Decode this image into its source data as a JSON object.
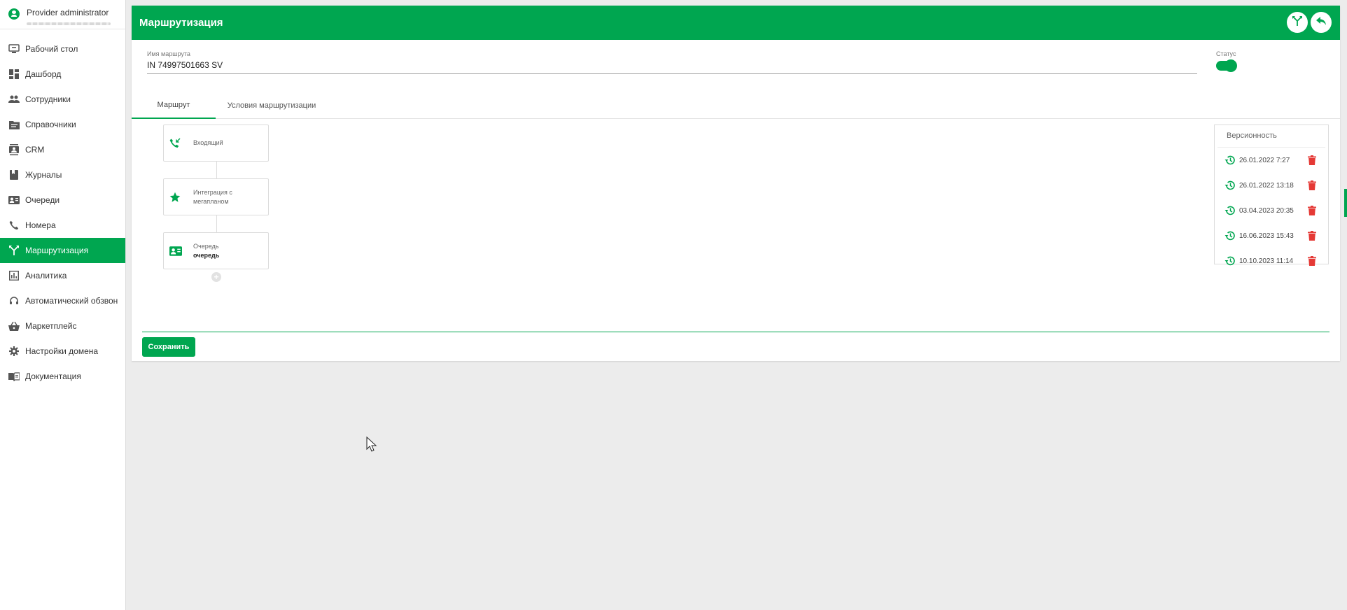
{
  "user": {
    "name": "Provider administrator"
  },
  "sidebar": {
    "items": [
      {
        "label": "Рабочий стол",
        "icon": "desktop-icon"
      },
      {
        "label": "Дашборд",
        "icon": "dashboard-icon"
      },
      {
        "label": "Сотрудники",
        "icon": "people-icon"
      },
      {
        "label": "Справочники",
        "icon": "folder-icon"
      },
      {
        "label": "CRM",
        "icon": "contacts-icon"
      },
      {
        "label": "Журналы",
        "icon": "book-icon"
      },
      {
        "label": "Очереди",
        "icon": "queue-card-icon"
      },
      {
        "label": "Номера",
        "icon": "phone-icon"
      },
      {
        "label": "Маршрутизация",
        "icon": "routing-icon",
        "active": true
      },
      {
        "label": "Аналитика",
        "icon": "analytics-icon"
      },
      {
        "label": "Автоматический обзвон",
        "icon": "headset-icon"
      },
      {
        "label": "Маркетплейс",
        "icon": "basket-icon"
      },
      {
        "label": "Настройки домена",
        "icon": "gear-icon"
      },
      {
        "label": "Документация",
        "icon": "documentation-icon"
      }
    ]
  },
  "header": {
    "title": "Маршрутизация"
  },
  "form": {
    "route_name_label": "Имя маршрута",
    "route_name_value": "IN 74997501663 SV",
    "status_label": "Статус",
    "status_on": true
  },
  "tabs": [
    {
      "label": "Маршрут",
      "active": true
    },
    {
      "label": "Условия маршрутизации",
      "active": false
    }
  ],
  "flow": [
    {
      "label": "Входящий",
      "icon": "incoming-call-icon"
    },
    {
      "label": "Интеграция с мегапланом",
      "icon": "star-icon"
    },
    {
      "label": "Очередь",
      "sublabel": "очередь",
      "icon": "queue-card-icon"
    }
  ],
  "versions": {
    "title": "Версионность",
    "items": [
      "26.01.2022 7:27",
      "26.01.2022 13:18",
      "03.04.2023 20:35",
      "16.06.2023 15:43",
      "10.10.2023 11:14"
    ]
  },
  "actions": {
    "save_label": "Сохранить"
  },
  "colors": {
    "accent": "#00a650",
    "delete": "#e53935"
  }
}
